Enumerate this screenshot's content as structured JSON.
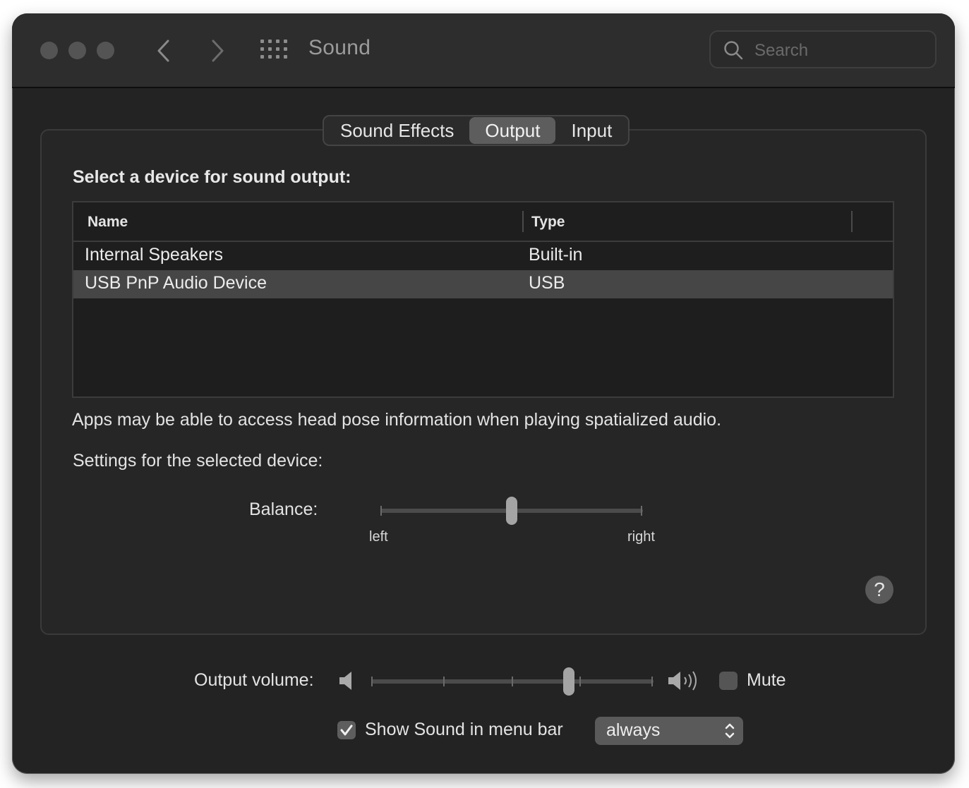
{
  "window": {
    "title": "Sound",
    "search_placeholder": "Search"
  },
  "tabs": [
    {
      "label": "Sound Effects",
      "active": false
    },
    {
      "label": "Output",
      "active": true
    },
    {
      "label": "Input",
      "active": false
    }
  ],
  "output": {
    "heading": "Select a device for sound output:",
    "columns": [
      "Name",
      "Type"
    ],
    "devices": [
      {
        "name": "Internal Speakers",
        "type": "Built-in",
        "selected": false
      },
      {
        "name": "USB PnP Audio Device",
        "type": "USB",
        "selected": true
      }
    ],
    "info_text": "Apps may be able to access head pose information when playing spatialized audio.",
    "settings_label": "Settings for the selected device:",
    "balance": {
      "label": "Balance:",
      "left_label": "left",
      "right_label": "right",
      "value": 0.5
    }
  },
  "volume": {
    "label": "Output volume:",
    "value": 0.7,
    "mute_label": "Mute",
    "mute_checked": false
  },
  "menubar": {
    "label": "Show Sound in menu bar",
    "checked": true,
    "select_value": "always"
  },
  "icons": {
    "search": "search-icon",
    "grid": "grid-icon",
    "back": "chevron-left-icon",
    "forward": "chevron-right-icon",
    "help": "help-icon",
    "speaker_low": "speaker-low-icon",
    "speaker_high": "speaker-high-icon",
    "checkmark": "checkmark-icon",
    "updown": "updown-arrows-icon"
  }
}
